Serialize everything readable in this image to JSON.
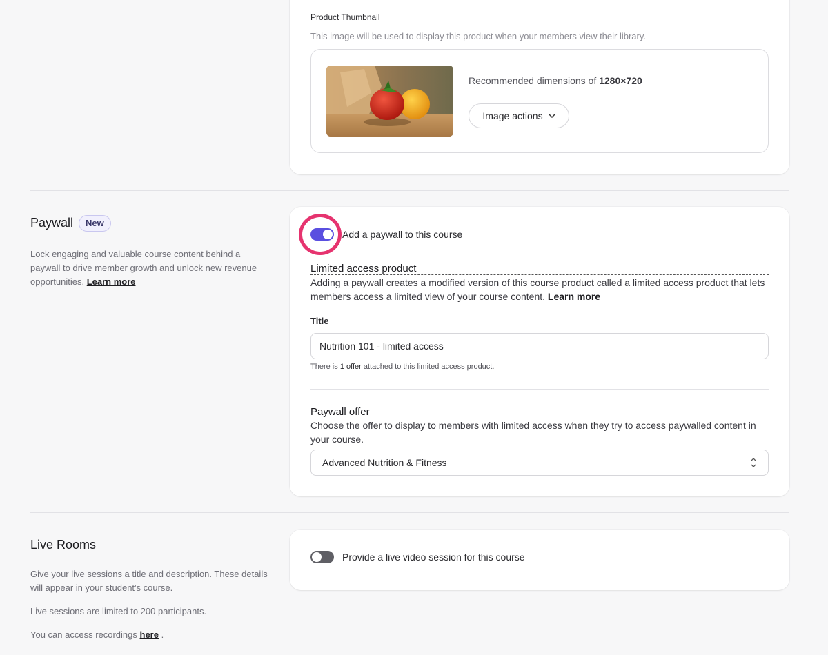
{
  "thumbnail": {
    "label": "Product Thumbnail",
    "description": "This image will be used to display this product when your members view their library.",
    "recommended_prefix": "Recommended dimensions of",
    "recommended_value": "1280×720",
    "image_actions_label": "Image actions"
  },
  "paywall": {
    "title": "Paywall",
    "badge": "New",
    "description": "Lock engaging and valuable course content behind a paywall to drive member growth and unlock new revenue opportunities.",
    "learn_more": "Learn more",
    "toggle_label": "Add a paywall to this course",
    "toggle_on": true,
    "limited_title": "Limited access product",
    "limited_desc": "Adding a paywall creates a modified version of this course product called a limited access product that lets members access a limited view of your course content.",
    "limited_learn_more": "Learn more",
    "title_label": "Title",
    "title_value": "Nutrition 101 - limited access",
    "note_prefix": "There is",
    "note_link": "1 offer",
    "note_suffix": "attached to this limited access product.",
    "offer_title": "Paywall offer",
    "offer_desc": "Choose the offer to display to members with limited access when they try to access paywalled content in your course.",
    "offer_selected": "Advanced Nutrition & Fitness"
  },
  "live_rooms": {
    "title": "Live Rooms",
    "desc1": "Give your live sessions a title and description. These details will appear in your student's course.",
    "desc2": "Live sessions are limited to 200 participants.",
    "desc3_prefix": "You can access recordings",
    "desc3_link": "here",
    "desc3_suffix": ".",
    "toggle_label": "Provide a live video session for this course",
    "toggle_on": false
  },
  "colors": {
    "accent": "#5a4fe0",
    "highlight": "#e6336f",
    "toggle_off": "#5f5f65"
  }
}
